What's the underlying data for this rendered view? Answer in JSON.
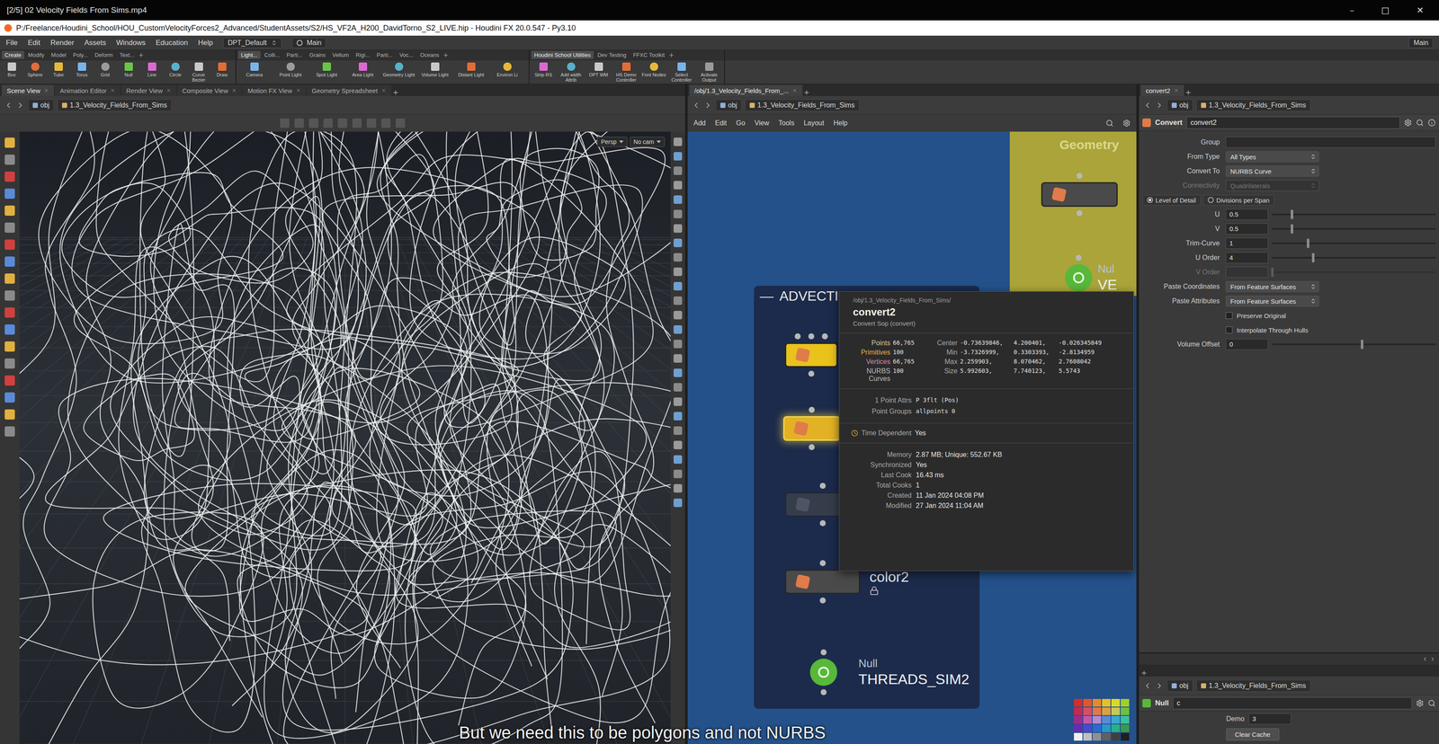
{
  "video_bar": {
    "title": "[2/5] 02 Velocity Fields From Sims.mp4",
    "controls": [
      "–",
      "□",
      "✕"
    ]
  },
  "window": {
    "title": "P:/Freelance/Houdini_School/HOU_CustomVelocityForces2_Advanced/StudentAssets/S2/HS_VF2A_H200_DavidTorno_S2_LIVE.hip - Houdini FX 20.0.547 - Py3.10"
  },
  "menu": [
    "File",
    "Edit",
    "Render",
    "Assets",
    "Windows",
    "Education",
    "Help"
  ],
  "desktop": "DPT_Default",
  "workspace": "Main",
  "workspace_right": "Main",
  "shelf_sets": [
    {
      "tabs": [
        {
          "label": "Create",
          "selected": true
        },
        {
          "label": "Modify",
          "selected": false
        },
        {
          "label": "Model",
          "selected": false
        },
        {
          "label": "Poly...",
          "selected": false
        },
        {
          "label": "Deform",
          "selected": false
        },
        {
          "label": "Text...",
          "selected": false
        }
      ],
      "tools": [
        "Box",
        "Sphere",
        "Tube",
        "Torus",
        "Grid",
        "Null",
        "Line",
        "Circle",
        "Curve Bezier",
        "Draw"
      ]
    },
    {
      "tabs": [
        {
          "label": "Light...",
          "selected": true
        },
        {
          "label": "Colli...",
          "selected": false
        },
        {
          "label": "Parti...",
          "selected": false
        },
        {
          "label": "Grains",
          "selected": false
        },
        {
          "label": "Vellum",
          "selected": false
        },
        {
          "label": "Rigi...",
          "selected": false
        },
        {
          "label": "Parti...",
          "selected": false
        },
        {
          "label": "Voc...",
          "selected": false
        },
        {
          "label": "Oceans",
          "selected": false
        }
      ],
      "tools": [
        "Camera",
        "Point Light",
        "Spot Light",
        "Area Light",
        "Geometry Light",
        "Volume Light",
        "Distant Light",
        "Environ Li"
      ]
    },
    {
      "tabs": [
        {
          "label": "Houdini School Utilities",
          "selected": true
        },
        {
          "label": "Dev Testing",
          "selected": false
        },
        {
          "label": "FFXC Toolkit",
          "selected": false
        }
      ],
      "tools": [
        "Strip RS",
        "Add width Attrib",
        "DPT WM",
        "HS Demo Controller",
        "Font Nodes",
        "Select Controller",
        "Activate Output"
      ]
    }
  ],
  "scene_pane": {
    "tabs": [
      {
        "label": "Scene View",
        "selected": true
      },
      {
        "label": "Animation Editor",
        "selected": false
      },
      {
        "label": "Render View",
        "selected": false
      },
      {
        "label": "Composite View",
        "selected": false
      },
      {
        "label": "Motion FX View",
        "selected": false
      },
      {
        "label": "Geometry Spreadsheet",
        "selected": false
      }
    ],
    "path": [
      "obj",
      "1.3_Velocity_Fields_From_Sims"
    ],
    "persp": "Persp",
    "camera": "No cam"
  },
  "network_pane": {
    "tab": "/obj/1.3_Velocity_Fields_From_...",
    "path": [
      "obj",
      "1.3_Velocity_Fields_From_Sims"
    ],
    "menu": [
      "Add",
      "Edit",
      "Go",
      "View",
      "Tools",
      "Layout",
      "Help"
    ],
    "advection_box": {
      "collapse": "—",
      "title": "ADVECTI",
      "color": "#1c2b4b"
    },
    "advection_nodes": [
      {
        "label": "",
        "sublabel": "",
        "kind": "sop",
        "color": "#e9c21c",
        "inputs": 3,
        "outlined": false,
        "dimmed": false,
        "locked": false
      },
      {
        "label": "",
        "sublabel": "",
        "kind": "sop",
        "color": "#e3b224",
        "inputs": 1,
        "outlined": true,
        "dimmed": false,
        "locked": false
      },
      {
        "label": "",
        "sublabel": "",
        "kind": "sop",
        "color": "#4a4a4a",
        "inputs": 1,
        "outlined": false,
        "dimmed": true,
        "locked": false
      },
      {
        "label": "color2",
        "sublabel": "",
        "kind": "sop",
        "color": "#4a4a4a",
        "inputs": 1,
        "outlined": false,
        "dimmed": false,
        "locked": true
      },
      {
        "label": "THREADS_SIM2",
        "sublabel": "Null",
        "kind": "null",
        "color": "#58b83a",
        "inputs": 1,
        "outlined": false,
        "dimmed": false,
        "locked": false
      }
    ],
    "geometry_box": {
      "title": "Geometry",
      "color": "#aaa43a"
    },
    "geometry_nodes": [
      {
        "label": "",
        "sublabel": "",
        "kind": "sop",
        "color": "#4a4a4a",
        "inputs": 1,
        "outlined": false,
        "dimmed": false,
        "locked": false
      },
      {
        "label": "VE",
        "sublabel": "Nul",
        "kind": "null",
        "color": "#58b83a",
        "inputs": 1,
        "outlined": false,
        "dimmed": false,
        "locked": false
      }
    ],
    "palette": [
      "#d92b2b",
      "#e0572a",
      "#e88a2a",
      "#e6c02a",
      "#d9d92a",
      "#9fd02a",
      "#c42a4f",
      "#d4506a",
      "#e07a4a",
      "#e0a040",
      "#c8c85a",
      "#6fc040",
      "#a02a8a",
      "#c05aa8",
      "#b58ad0",
      "#5a8ad8",
      "#3aa8d0",
      "#3ac0a0",
      "#6a2ab0",
      "#4a4ac8",
      "#2a6ad0",
      "#2a98c8",
      "#2ab08a",
      "#3a9a4a",
      "#f0f0f0",
      "#c0c0c0",
      "#909090",
      "#606060",
      "#404040",
      "#202020"
    ]
  },
  "tooltip": {
    "path": "/obj/1.3_Velocity_Fields_From_Sims/",
    "name": "convert2",
    "type": "Convert Sop (convert)",
    "stats": [
      {
        "label": "Points",
        "value": "66,765",
        "color": "#d8c89c"
      },
      {
        "label": "Primitives",
        "value": "100",
        "color": "#e6b04c"
      },
      {
        "label": "Vertices",
        "value": "66,765",
        "color": "#d98aa2"
      },
      {
        "label": "NURBS Curves",
        "value": "100",
        "color": "#bdbdbd"
      }
    ],
    "bounds": [
      {
        "label": "Center",
        "values": [
          "-0.73639846,",
          "4.200401,",
          "-0.026345849"
        ]
      },
      {
        "label": "Min",
        "values": [
          "-3.7326999,",
          "0.3303393,",
          "-2.8134959"
        ]
      },
      {
        "label": "Max",
        "values": [
          "2.259903,",
          "8.070462,",
          "2.7608042"
        ]
      },
      {
        "label": "Size",
        "values": [
          "5.992603,",
          "7.740123,",
          "5.5743"
        ]
      }
    ],
    "attrs": {
      "label": "1 Point Attrs",
      "value": "P 3flt (Pos)"
    },
    "groups": {
      "label": "Point Groups",
      "value": "allpoints 0"
    },
    "time_dependent": {
      "label": "Time Dependent",
      "value": "Yes"
    },
    "info": [
      {
        "label": "Memory",
        "value": "2.87 MB; Unique: 552.67 KB"
      },
      {
        "label": "Synchronized",
        "value": "Yes"
      },
      {
        "label": "Last Cook",
        "value": "16.43 ms"
      },
      {
        "label": "Total Cooks",
        "value": "1"
      },
      {
        "label": "Created",
        "value": "11 Jan 2024 04:08 PM"
      },
      {
        "label": "Modified",
        "value": "27 Jan 2024 11:04 AM"
      }
    ]
  },
  "param_pane": {
    "tab": "convert2",
    "path": [
      "obj",
      "1.3_Velocity_Fields_From_Sims"
    ],
    "type": "Convert",
    "name": "convert2",
    "params": [
      {
        "kind": "text",
        "label": "Group",
        "value": "",
        "disabled": false
      },
      {
        "kind": "menu",
        "label": "From Type",
        "value": "All Types",
        "disabled": false
      },
      {
        "kind": "menu",
        "label": "Convert To",
        "value": "NURBS Curve",
        "disabled": false
      },
      {
        "kind": "menu",
        "label": "Connectivity",
        "value": "Quadrilaterals",
        "disabled": true
      },
      {
        "kind": "radio",
        "label": "",
        "options": [
          {
            "label": "Level of Detail",
            "selected": true
          },
          {
            "label": "Divisions per Span",
            "selected": false
          }
        ]
      },
      {
        "kind": "slider",
        "label": "U",
        "value": "0.5",
        "level": 0.12,
        "disabled": false
      },
      {
        "kind": "slider",
        "label": "V",
        "value": "0.5",
        "level": 0.12,
        "disabled": false
      },
      {
        "kind": "slider",
        "label": "Trim-Curve",
        "value": "1",
        "level": 0.22,
        "disabled": false
      },
      {
        "kind": "slider",
        "label": "U Order",
        "value": "4",
        "level": 0.25,
        "disabled": false
      },
      {
        "kind": "slider",
        "label": "V Order",
        "value": "",
        "level": 0,
        "disabled": true
      },
      {
        "kind": "menu",
        "label": "Paste Coordinates",
        "value": "From Feature Surfaces",
        "disabled": false
      },
      {
        "kind": "menu",
        "label": "Paste Attributes",
        "value": "From Feature Surfaces",
        "disabled": false
      },
      {
        "kind": "checkbox",
        "label": "Preserve Original",
        "checked": false
      },
      {
        "kind": "checkbox",
        "label": "Interpolate Through Hulls",
        "checked": false
      },
      {
        "kind": "slider",
        "label": "Volume Offset",
        "value": "0",
        "level": 0.55,
        "disabled": false
      }
    ]
  },
  "lower_param_pane": {
    "path": [
      "obj",
      "1.3_Velocity_Fields_From_Sims"
    ],
    "type": "Null",
    "name": "c",
    "params": [
      {
        "label": "Demo",
        "value": "3"
      }
    ],
    "button": "Clear Cache"
  },
  "subtitle": "But we need this to be polygons and not NURBS"
}
